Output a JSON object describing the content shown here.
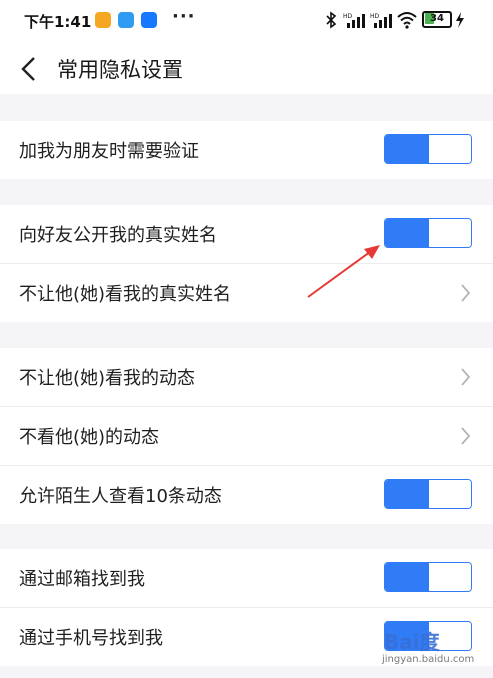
{
  "status_bar": {
    "time": "下午1:41",
    "more": "···",
    "battery": "34",
    "icons": [
      "bluetooth-icon",
      "signal-hd-icon",
      "signal-hd-icon",
      "wifi-icon",
      "battery-icon",
      "charging-icon"
    ],
    "app_icons": [
      "notes-app-icon",
      "chat-app-icon",
      "alipay-app-icon"
    ]
  },
  "header": {
    "back_icon": "chevron-left-icon",
    "title": "常用隐私设置"
  },
  "groups": [
    {
      "rows": [
        {
          "label": "加我为朋友时需要验证",
          "control": "toggle",
          "on": true
        }
      ]
    },
    {
      "rows": [
        {
          "label": "向好友公开我的真实姓名",
          "control": "toggle",
          "on": true
        },
        {
          "label": "不让他(她)看我的真实姓名",
          "control": "chevron"
        }
      ]
    },
    {
      "rows": [
        {
          "label": "不让他(她)看我的动态",
          "control": "chevron"
        },
        {
          "label": "不看他(她)的动态",
          "control": "chevron"
        },
        {
          "label": "允许陌生人查看10条动态",
          "control": "toggle",
          "on": true
        }
      ]
    },
    {
      "rows": [
        {
          "label": "通过邮箱找到我",
          "control": "toggle",
          "on": true
        },
        {
          "label": "通过手机号找到我",
          "control": "toggle",
          "on": true
        }
      ]
    }
  ],
  "annotation": {
    "arrow_color": "#e53935"
  },
  "watermark": {
    "logo": "Bai度",
    "url": "jingyan.baidu.com"
  },
  "colors": {
    "accent": "#2f7cf6",
    "background": "#f5f5f7"
  }
}
